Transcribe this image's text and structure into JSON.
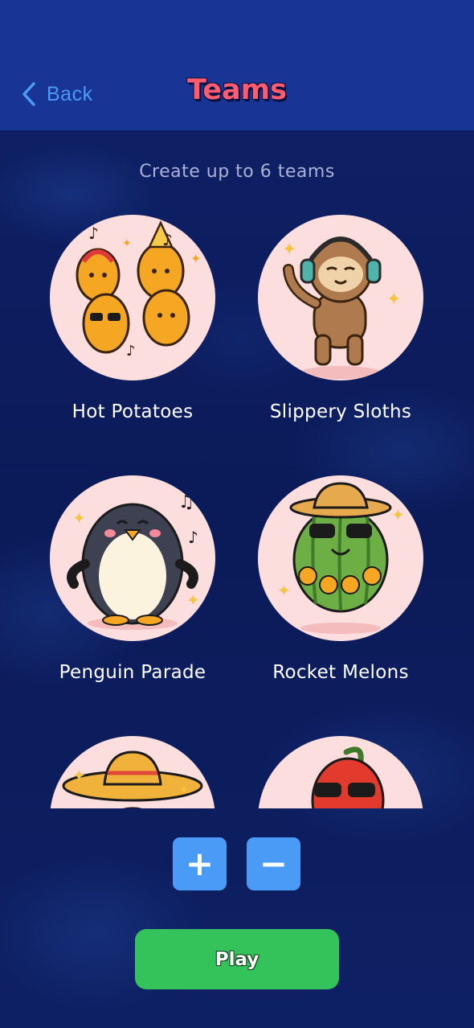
{
  "header": {
    "back_label": "Back",
    "title": "Teams"
  },
  "subtitle": "Create up to 6 teams",
  "teams": [
    {
      "name": "Hot Potatoes",
      "icon": "dancing-potatoes-icon"
    },
    {
      "name": "Slippery Sloths",
      "icon": "dancing-sloth-icon"
    },
    {
      "name": "Penguin Parade",
      "icon": "dancing-penguin-icon"
    },
    {
      "name": "Rocket Melons",
      "icon": "dancing-watermelon-icon"
    },
    {
      "name": "",
      "icon": "sombrero-taco-icon"
    },
    {
      "name": "",
      "icon": "cool-pepper-icon"
    }
  ],
  "controls": {
    "add_label": "+",
    "remove_label": "−",
    "play_label": "Play"
  },
  "colors": {
    "header": "#183494",
    "background": "#0d1c5c",
    "accent_blue": "#4a9bf5",
    "title": "#ff5c70",
    "play": "#33c35a",
    "avatar_bg": "#fddede"
  }
}
